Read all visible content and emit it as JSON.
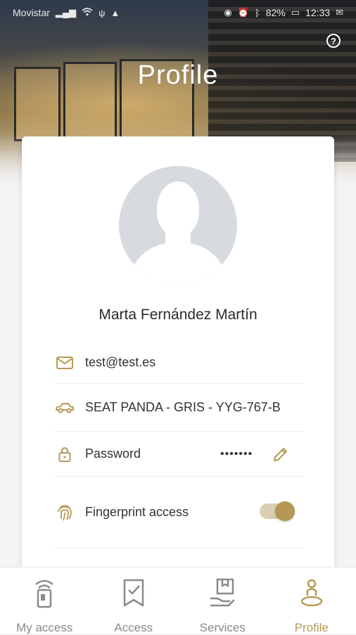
{
  "status_bar": {
    "carrier": "Movistar",
    "battery": "82%",
    "time": "12:33"
  },
  "header": {
    "title": "Profile",
    "help_icon": "question-circle-icon"
  },
  "profile": {
    "name": "Marta Fernández Martín",
    "email": "test@test.es",
    "vehicle": "SEAT PANDA - GRIS - YYG-767-B",
    "password_label": "Password",
    "password_mask": "•••••••",
    "fingerprint_label": "Fingerprint access",
    "fingerprint_enabled": true
  },
  "colors": {
    "accent": "#b79a55",
    "inactive": "#8a8a8a"
  },
  "nav": {
    "items": [
      {
        "label": "My access",
        "icon": "phone-access-icon",
        "active": false
      },
      {
        "label": "Access",
        "icon": "access-check-icon",
        "active": false
      },
      {
        "label": "Services",
        "icon": "services-icon",
        "active": false
      },
      {
        "label": "Profile",
        "icon": "profile-icon",
        "active": true
      }
    ]
  }
}
